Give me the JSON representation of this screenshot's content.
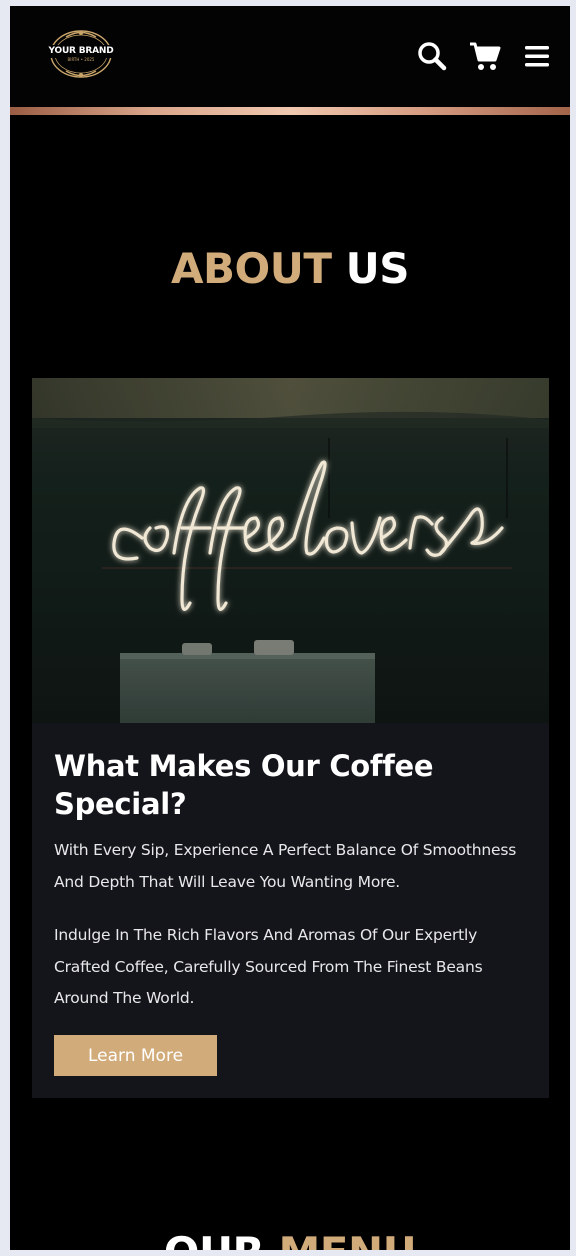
{
  "header": {
    "brand_name": "YOUR BRAND",
    "brand_tagline": "BIRTH • 2025",
    "icons": [
      "search-icon",
      "cart-icon",
      "menu-icon"
    ]
  },
  "about": {
    "title_accent": "ABOUT",
    "title_white": "US",
    "image_text": "coffeelovers",
    "heading": "What Makes Our Coffee Special?",
    "paragraph_1": "With Every Sip, Experience A Perfect Balance Of Smoothness And Depth That Will Leave You Wanting More.",
    "paragraph_2": "Indulge In The Rich Flavors And Aromas Of Our Expertly Crafted Coffee, Carefully Sourced From The Finest Beans Around The World.",
    "button_label": "Learn More"
  },
  "menu_section": {
    "title_white": "OUR",
    "title_accent": "MENU"
  },
  "colors": {
    "accent": "#d2ab7a",
    "background": "#000000",
    "card": "#14151b",
    "frame": "#e6e9f2"
  }
}
